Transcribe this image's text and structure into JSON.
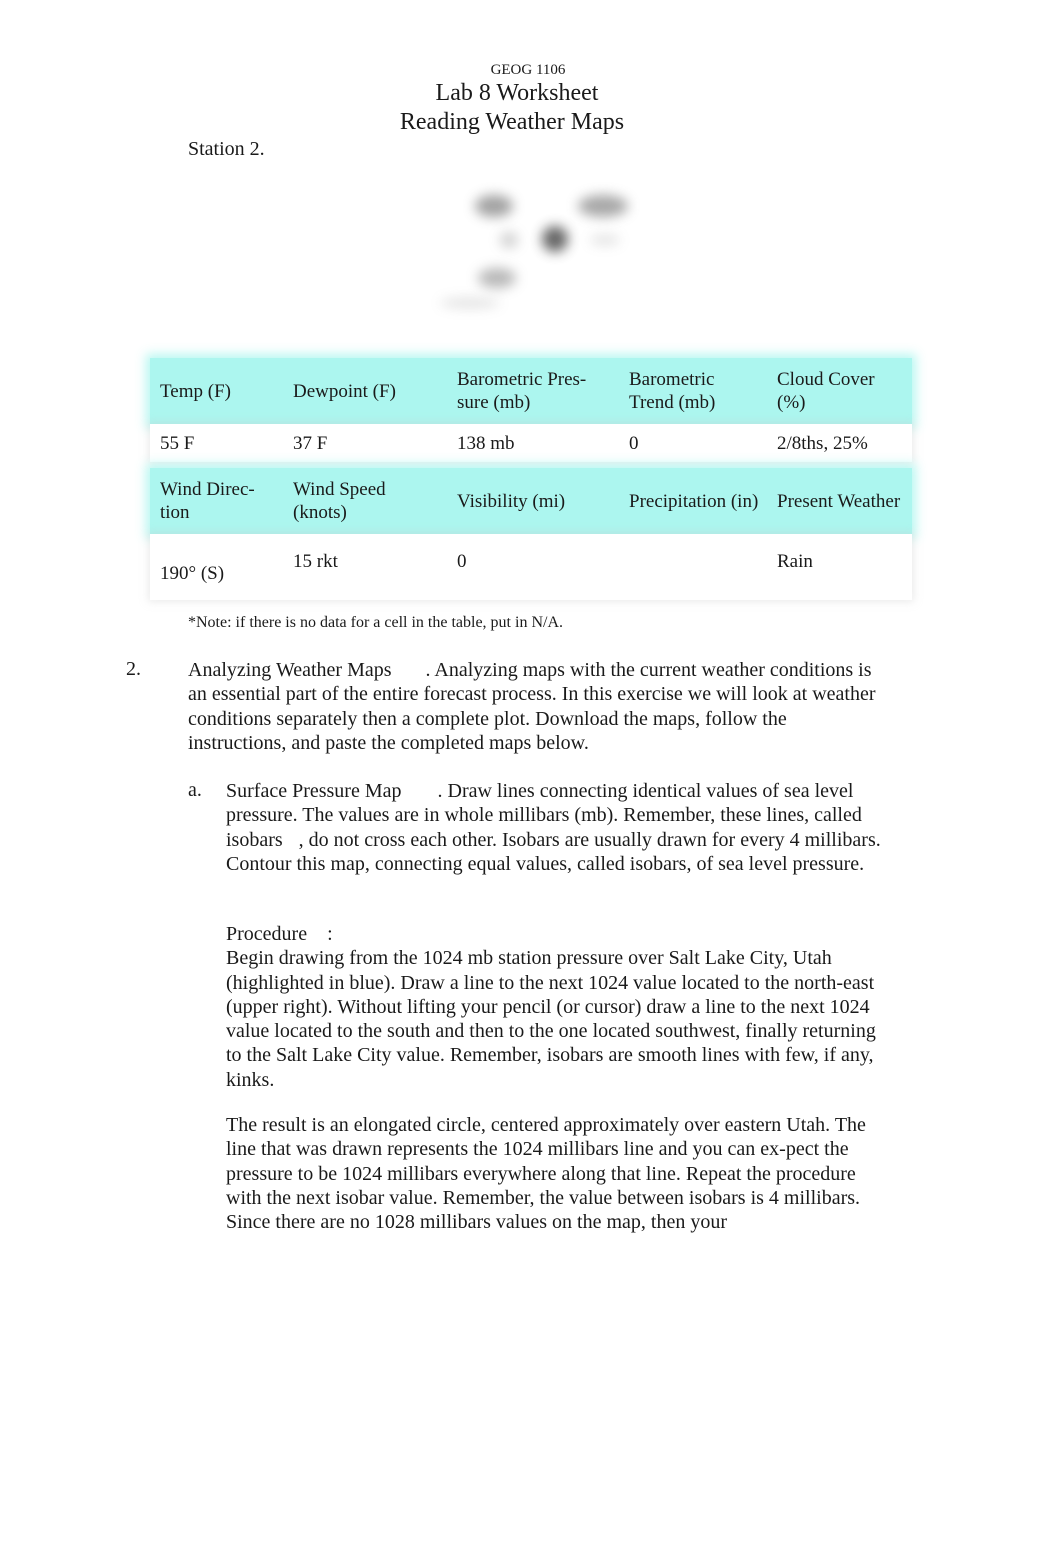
{
  "header": {
    "course": "GEOG 1106",
    "title": "Lab 8 Worksheet",
    "subtitle": "Reading Weather Maps"
  },
  "station_label": "Station 2.",
  "station_figure": {
    "description": "blurred station model plot"
  },
  "table": {
    "row1_headers": [
      "Temp (F)",
      "Dewpoint (F)",
      "Barometric Pres-sure (mb)",
      "Barometric Trend (mb)",
      "Cloud Cover (%)"
    ],
    "row1_values": [
      "55 F",
      "37 F",
      "138 mb",
      "0",
      "2/8ths, 25%"
    ],
    "row2_headers": [
      "Wind Direc-tion",
      "Wind Speed (knots)",
      "Visibility (mi)",
      "Precipitation (in)",
      "Present Weather"
    ],
    "row2_values": [
      "190° (S)",
      "15 rkt",
      "0",
      "",
      "Rain"
    ],
    "colors": {
      "header_bg": "#acf6ef",
      "value_bg": "#ffffff"
    }
  },
  "note": "*Note: if there is no data for a cell in the table, put in N/A.",
  "section2": {
    "number": "2.",
    "heading": "Analyzing Weather Maps",
    "body": ". Analyzing maps with the current weather conditions is an essential part of the entire forecast process. In this exercise we will look at weather conditions separately then a complete plot. Download the maps, follow the instructions, and paste the completed maps below."
  },
  "part_a": {
    "letter": "a.",
    "heading": "Surface Pressure Map",
    "body_1": ". Draw lines connecting identical values of sea level pressure. The values are in whole millibars (mb). Remember, these lines, called ",
    "term": "isobars",
    "body_2": ", do not cross each other. Isobars are usually drawn for every 4 millibars. Contour this map, connecting equal values, called isobars, of sea level pressure.",
    "procedure_label": "Procedure",
    "procedure_colon": ":",
    "procedure_text": "Begin drawing from the 1024 mb station pressure over Salt Lake City, Utah (highlighted in blue). Draw a line to the next 1024 value located to the north-east (upper right). Without lifting your pencil (or cursor) draw a line to the next 1024 value located to the south and then to the one located southwest, finally returning to the Salt Lake City value. Remember, isobars are smooth lines with few, if any, kinks.",
    "result_text": "The result is an elongated circle, centered approximately over eastern Utah. The line that was drawn represents the 1024 millibars line and you can ex-pect the pressure to be 1024 millibars everywhere along that line. Repeat the procedure with the next isobar value. Remember, the value between isobars is 4 millibars. Since there are no 1028 millibars values on the map, then your"
  }
}
